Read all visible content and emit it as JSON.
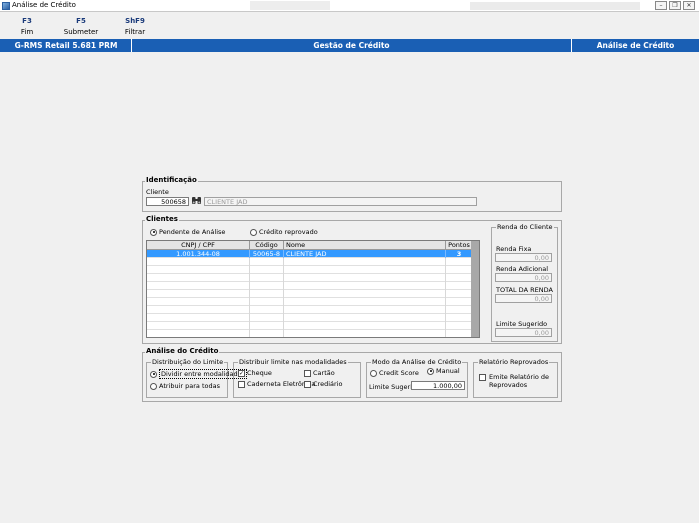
{
  "window": {
    "title": "Análise de Crédito"
  },
  "toolbar": {
    "items": [
      {
        "key": "F3",
        "label": "Fim"
      },
      {
        "key": "F5",
        "label": "Submeter Análise"
      },
      {
        "key": "ShF9",
        "label": "Filtrar"
      }
    ]
  },
  "header": {
    "app_name": "G-RMS Retail 5.681 PRM",
    "module": "Gestão de Crédito",
    "screen": "Análise de Crédito",
    "background_color": "#1a5fb4"
  },
  "identificacao": {
    "title": "Identificação",
    "cliente_label": "Cliente",
    "cliente_code": "500658",
    "search_icon": "binoculars-icon",
    "cliente_name": "CLIENTE JAD"
  },
  "clientes": {
    "title": "Clientes",
    "radio_pendente": "Pendente de Análise",
    "radio_reprovado": "Crédito reprovado",
    "selected_filter": "Pendente de Análise",
    "columns": [
      "CNPJ / CPF",
      "Código",
      "Nome",
      "Pontos"
    ],
    "rows": [
      {
        "cnpj": "1.001.344-08",
        "codigo": "50065-8",
        "nome": "CLIENTE JAD",
        "pontos": "3"
      }
    ]
  },
  "renda": {
    "title": "Renda do Cliente",
    "fixa_label": "Renda Fixa",
    "fixa_value": "0,00",
    "adicional_label": "Renda Adicional",
    "adicional_value": "0,00",
    "total_label": "TOTAL DA RENDA",
    "total_value": "0,00",
    "limite_label": "Limite Sugerido",
    "limite_value": "0,00"
  },
  "analise": {
    "title": "Análise do Crédito",
    "distribuicao": {
      "title": "Distribuição do Limite",
      "opt_dividir": "Dividir entre modalidades",
      "opt_atribuir": "Atribuir para todas",
      "selected": "Dividir entre modalidades"
    },
    "modalidades": {
      "title": "Distribuir limite nas modalidades",
      "cheque": "Cheque",
      "cartao": "Cartão",
      "caderneta": "Caderneta Eletrônica",
      "crediario": "Crediário",
      "checked": [
        "Cheque"
      ]
    },
    "modo": {
      "title": "Modo da Análise de Crédito",
      "opt_score": "Credit Score",
      "opt_manual": "Manual",
      "selected": "Manual",
      "limite_label": "Limite Sugerido",
      "limite_value": "1.000,00"
    },
    "relatorio": {
      "title": "Relatório Reprovados",
      "emite_label_1": "Emite Relatório de",
      "emite_label_2": "Reprovados"
    }
  }
}
